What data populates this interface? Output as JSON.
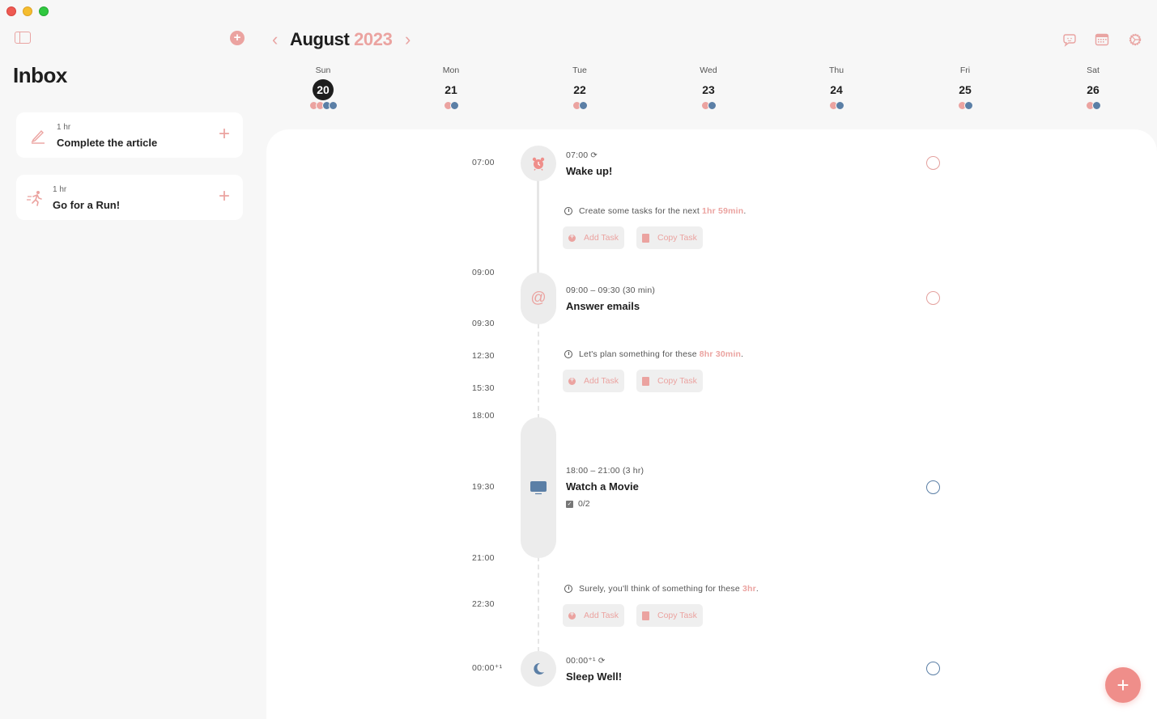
{
  "window": {
    "traffic_lights": [
      "close",
      "minimize",
      "maximize"
    ]
  },
  "sidebar": {
    "toggle_icon": "sidebar-icon",
    "add_icon": "plus-circle-icon",
    "title": "Inbox",
    "items": [
      {
        "icon": "pencil-icon",
        "duration": "1 hr",
        "title": "Complete the article",
        "add_label": "+"
      },
      {
        "icon": "running-icon",
        "duration": "1 hr",
        "title": "Go for a Run!",
        "add_label": "+"
      }
    ]
  },
  "header": {
    "prev_label": "‹",
    "next_label": "›",
    "month": "August",
    "year": "2023",
    "icons": [
      "feedback-icon",
      "calendar-icon",
      "settings-icon"
    ]
  },
  "week": {
    "days": [
      {
        "name": "Sun",
        "date": "20",
        "today": true,
        "dots": [
          "pink",
          "pink",
          "blue",
          "blue"
        ]
      },
      {
        "name": "Mon",
        "date": "21",
        "today": false,
        "dots": [
          "pink",
          "blue"
        ]
      },
      {
        "name": "Tue",
        "date": "22",
        "today": false,
        "dots": [
          "pink",
          "blue"
        ]
      },
      {
        "name": "Wed",
        "date": "23",
        "today": false,
        "dots": [
          "pink",
          "blue"
        ]
      },
      {
        "name": "Thu",
        "date": "24",
        "today": false,
        "dots": [
          "pink",
          "blue"
        ]
      },
      {
        "name": "Fri",
        "date": "25",
        "today": false,
        "dots": [
          "pink",
          "blue"
        ]
      },
      {
        "name": "Sat",
        "date": "26",
        "today": false,
        "dots": [
          "pink",
          "blue"
        ]
      }
    ]
  },
  "timeline": {
    "time_labels": [
      "07:00",
      "09:00",
      "09:30",
      "12:30",
      "15:30",
      "18:00",
      "19:30",
      "21:00",
      "22:30",
      "00:00⁺¹"
    ],
    "events": [
      {
        "icon": "alarm-clock-icon",
        "time": "07:00",
        "repeat": true,
        "title": "Wake up!",
        "done": false
      },
      {
        "icon": "at-sign-icon",
        "time": "09:00 – 09:30 (30 min)",
        "repeat": false,
        "title": "Answer emails",
        "done": false
      },
      {
        "icon": "tv-icon",
        "time": "18:00 – 21:00 (3 hr)",
        "repeat": false,
        "title": "Watch a Movie",
        "subtasks": "0/2",
        "done": false
      },
      {
        "icon": "moon-icon",
        "time": "00:00⁺¹",
        "repeat": true,
        "title": "Sleep Well!",
        "done": false
      }
    ],
    "gaps": [
      {
        "text": "Create some tasks for the next",
        "highlight": "1hr 59min",
        "suffix": "."
      },
      {
        "text": "Let's plan something for these",
        "highlight": "8hr 30min",
        "suffix": "."
      },
      {
        "text": "Surely, you'll think of something for these",
        "highlight": "3hr",
        "suffix": "."
      }
    ],
    "add_task_label": "Add Task",
    "copy_task_label": "Copy Task"
  },
  "fab_label": "+",
  "colors": {
    "accent": "#eba3a0",
    "blue": "#5b7fa6",
    "fab": "#ef8e8a"
  }
}
